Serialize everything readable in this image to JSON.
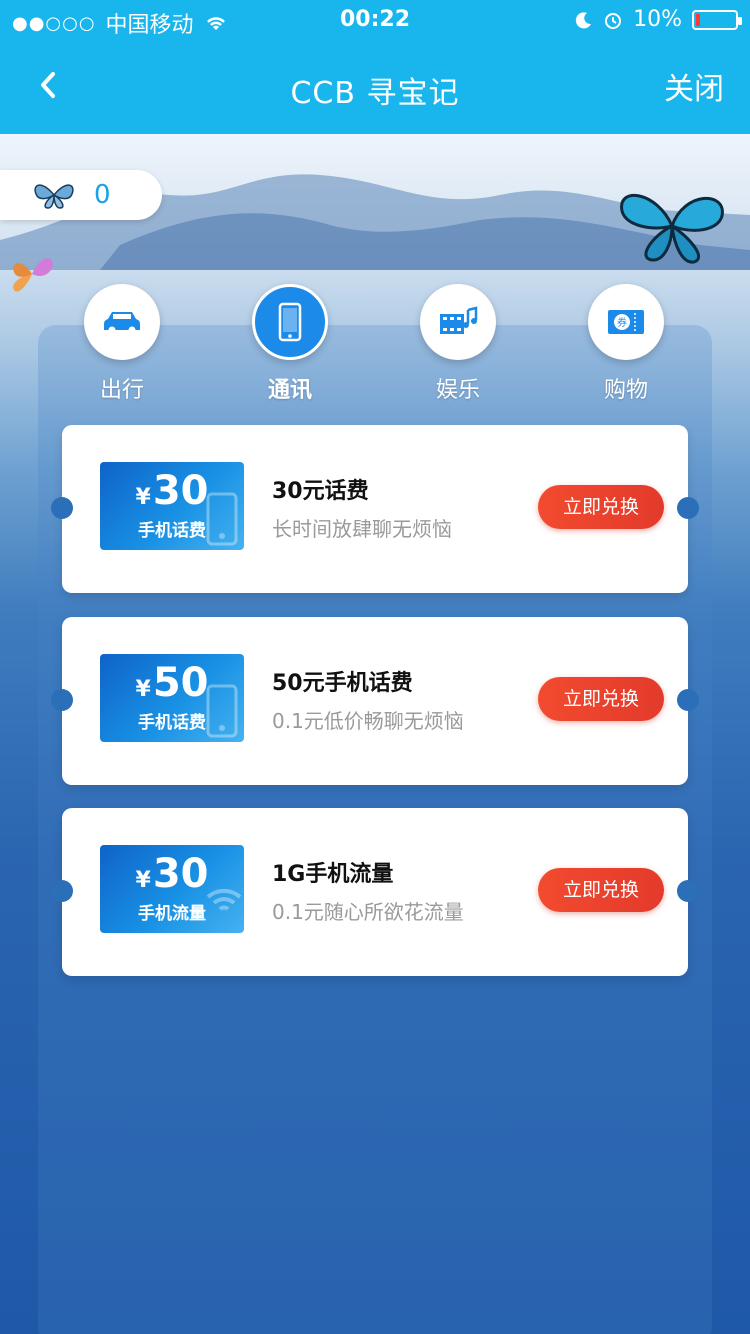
{
  "status_bar": {
    "signal": "●●○○○",
    "carrier": "中国移动",
    "time": "00:22",
    "battery": "10%"
  },
  "nav": {
    "title": "CCB 寻宝记",
    "close_label": "关闭"
  },
  "score": {
    "value": "0"
  },
  "categories": [
    {
      "label": "出行",
      "icon": "car-icon",
      "active": false
    },
    {
      "label": "通讯",
      "icon": "phone-icon",
      "active": true
    },
    {
      "label": "娱乐",
      "icon": "film-music-icon",
      "active": false
    },
    {
      "label": "购物",
      "icon": "coupon-icon",
      "active": false
    }
  ],
  "items": [
    {
      "coupon_symbol": "¥",
      "coupon_amount": "30",
      "coupon_text": "手机话费",
      "title": "30元话费",
      "desc": "长时间放肆聊无烦恼",
      "button": "立即兑换"
    },
    {
      "coupon_symbol": "¥",
      "coupon_amount": "50",
      "coupon_text": "手机话费",
      "title": "50元手机话费",
      "desc": "0.1元低价畅聊无烦恼",
      "button": "立即兑换"
    },
    {
      "coupon_symbol": "¥",
      "coupon_amount": "30",
      "coupon_text": "手机流量",
      "title": "1G手机流量",
      "desc": "0.1元随心所欲花流量",
      "button": "立即兑换"
    }
  ],
  "colors": {
    "nav_bg": "#19b6ee",
    "active_category": "#1c8ae8",
    "button": "#f24b2f",
    "accent_text": "#1aa2e6"
  }
}
